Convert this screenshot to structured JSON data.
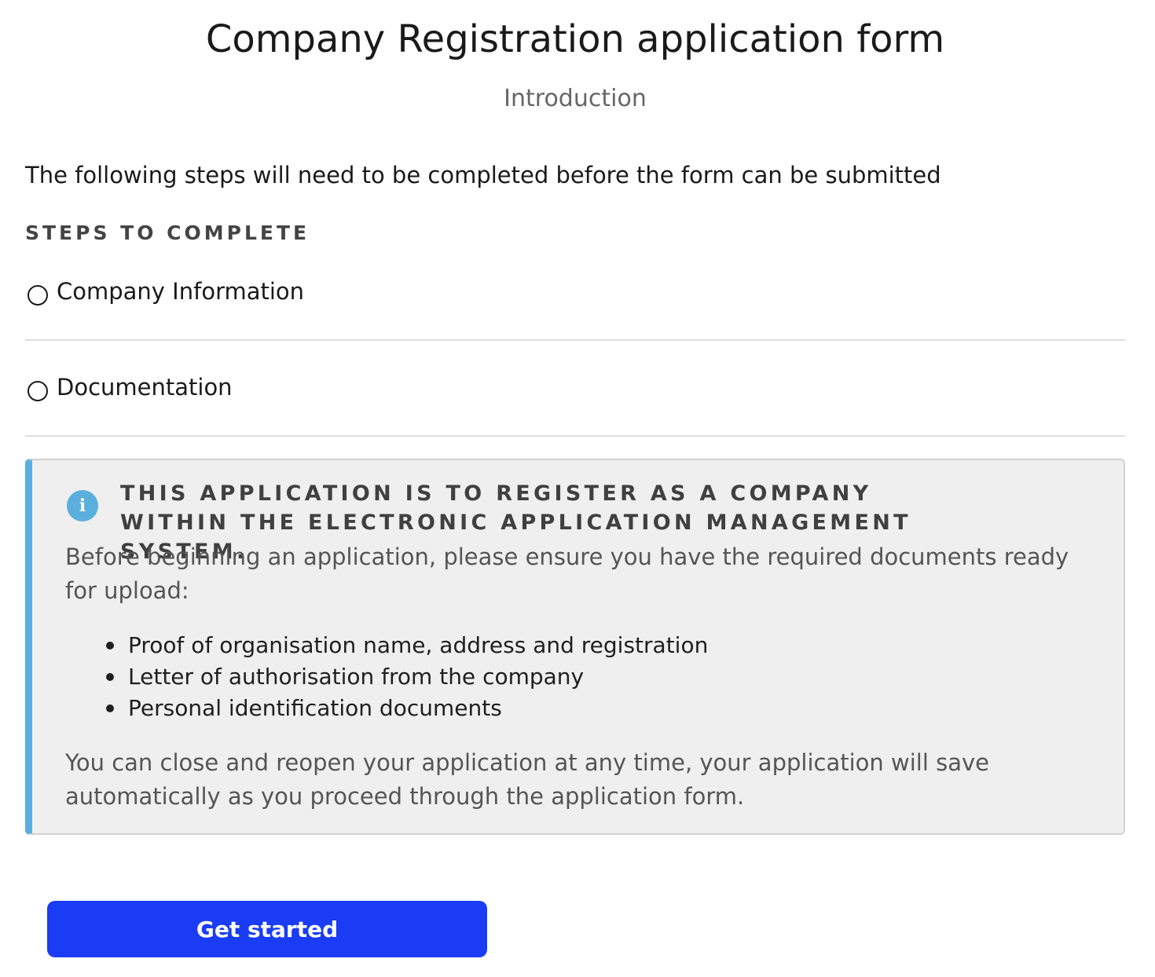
{
  "header": {
    "title": "Company Registration application form",
    "subtitle": "Introduction"
  },
  "intro": {
    "text": "The following steps will need to be completed before the form can be submitted"
  },
  "steps": {
    "heading": "STEPS TO COMPLETE",
    "items": [
      {
        "label": "Company Information",
        "status": "incomplete"
      },
      {
        "label": "Documentation",
        "status": "incomplete"
      }
    ]
  },
  "info": {
    "icon": "info-icon",
    "icon_glyph": "i",
    "accent_color": "#5aafdd",
    "heading": "THIS APPLICATION IS TO REGISTER AS A COMPANY WITHIN THE ELECTRONIC APPLICATION MANAGEMENT SYSTEM.",
    "paragraph1": "Before beginning an application, please ensure you have the required documents ready for upload:",
    "documents": [
      "Proof of organisation name, address and registration",
      "Letter of authorisation from the company",
      "Personal identification documents"
    ],
    "paragraph2": "You can close and reopen your application at any time, your application will save automatically as you proceed through the application form."
  },
  "actions": {
    "get_started_label": "Get started",
    "button_color": "#1a3cf5"
  }
}
